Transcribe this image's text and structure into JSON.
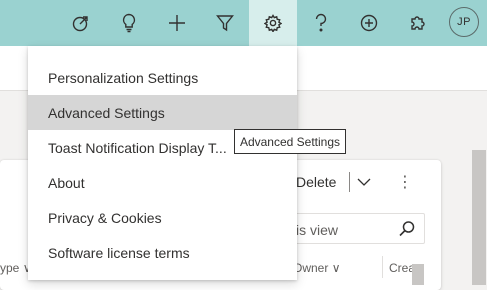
{
  "topbar": {
    "background": "#9ad2d0",
    "active_background": "#d7eeec",
    "icons": [
      "assist-icon",
      "lightbulb-icon",
      "plus-icon",
      "filter-icon",
      "gear-icon",
      "help-icon",
      "add-circle-icon",
      "puzzle-icon"
    ],
    "avatar_initials": "JP"
  },
  "settings_menu": {
    "items": [
      {
        "label": "Personalization Settings"
      },
      {
        "label": "Advanced Settings"
      },
      {
        "label": "Toast Notification Display T..."
      },
      {
        "label": "About"
      },
      {
        "label": "Privacy & Cookies"
      },
      {
        "label": "Software license terms"
      }
    ],
    "hovered_index": 1,
    "hover_color": "#d6d6d6"
  },
  "tooltip": {
    "text": "Advanced Settings"
  },
  "grid": {
    "delete_label": "Delete",
    "search_placeholder": "is view",
    "columns": {
      "type": "ype",
      "owner": "Owner",
      "created": "Crea"
    }
  }
}
